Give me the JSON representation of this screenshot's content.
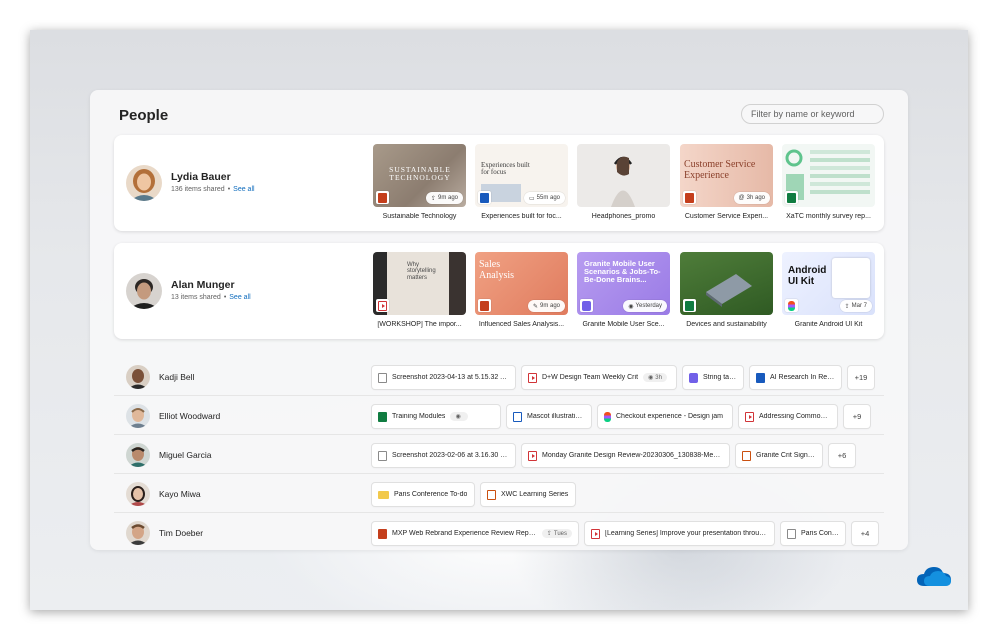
{
  "panel": {
    "title": "People",
    "filter_placeholder": "Filter by name or keyword"
  },
  "people_cards": [
    {
      "name": "Lydia Bauer",
      "subtitle": "136 items shared",
      "see_all": "See all",
      "files": [
        {
          "caption": "Sustainable Technology",
          "badge": "9m ago",
          "type": "powerpoint",
          "art_text": "SUSTAINABLE TECHNOLOGY"
        },
        {
          "caption": "Experiences built for foc...",
          "badge": "55m ago",
          "type": "word",
          "art_text": "Experiences built for focus"
        },
        {
          "caption": "Headphones_promo",
          "badge": "",
          "type": "image",
          "art_text": ""
        },
        {
          "caption": "Customer Service Experi...",
          "badge": "3h ago",
          "type": "powerpoint",
          "art_text": "Customer Service Experience"
        },
        {
          "caption": "XaTC monthly survey rep...",
          "badge": "",
          "type": "excel",
          "art_text": ""
        }
      ]
    },
    {
      "name": "Alan Munger",
      "subtitle": "13 items shared",
      "see_all": "See all",
      "files": [
        {
          "caption": "[WORKSHOP] The impor...",
          "badge": "",
          "type": "video",
          "art_text": "Why storytelling matters"
        },
        {
          "caption": "Influenced Sales Analysis...",
          "badge": "9m ago",
          "type": "powerpoint",
          "art_text": "Sales Analysis"
        },
        {
          "caption": "Granite Mobile User Sce...",
          "badge": "Yesterday",
          "type": "loop",
          "art_text": "Granite Mobile User Scenarios & Jobs-To-Be-Done Brains..."
        },
        {
          "caption": "Devices and sustainability",
          "badge": "",
          "type": "excel",
          "art_text": ""
        },
        {
          "caption": "Granite Android UI Kit",
          "badge": "Mar 7",
          "type": "figma",
          "art_text": "Android UI Kit"
        }
      ]
    }
  ],
  "people_rows": [
    {
      "name": "Kadji Bell",
      "files": [
        {
          "label": "Screenshot 2023-04-13 at 5.15.32 AM",
          "icon": "image",
          "badge": ""
        },
        {
          "label": "D+W Design Team Weekly Crit",
          "icon": "video",
          "badge": "3h"
        },
        {
          "label": "String table",
          "icon": "loop",
          "badge": ""
        },
        {
          "label": "AI Research In Resh...",
          "icon": "word",
          "badge": ""
        }
      ],
      "more": "+19"
    },
    {
      "name": "Elliot Woodward",
      "files": [
        {
          "label": "Training Modules",
          "icon": "excel",
          "badge": "49m ago"
        },
        {
          "label": "Mascot illustrations",
          "icon": "doc",
          "badge": ""
        },
        {
          "label": "Checkout experience - Design jam",
          "icon": "figma",
          "badge": ""
        },
        {
          "label": "Addressing Common Mi...",
          "icon": "video",
          "badge": ""
        }
      ],
      "more": "+9"
    },
    {
      "name": "Miguel Garcia",
      "files": [
        {
          "label": "Screenshot 2023-02-06 at 3.16.30 PM",
          "icon": "image",
          "badge": ""
        },
        {
          "label": "Monday Granite Design Review-20230306_130838-Meeti...",
          "icon": "video",
          "badge": ""
        },
        {
          "label": "Granite Crit Sign up",
          "icon": "whiteboard",
          "badge": ""
        }
      ],
      "more": "+6"
    },
    {
      "name": "Kayo Miwa",
      "files": [
        {
          "label": "Paris Conference To-do",
          "icon": "folder",
          "badge": ""
        },
        {
          "label": "XWC Learning Series",
          "icon": "whiteboard",
          "badge": ""
        }
      ],
      "more": ""
    },
    {
      "name": "Tim Doeber",
      "files": [
        {
          "label": "MXP Web Rebrand Experience Review Report",
          "icon": "powerpoint",
          "badge": "Tues"
        },
        {
          "label": "[Learning Series] Improve your presentation throug...",
          "icon": "video",
          "badge": ""
        },
        {
          "label": "Paris Confe...",
          "icon": "image",
          "badge": ""
        }
      ],
      "more": "+4"
    }
  ],
  "colors": {
    "accent": "#0f6cbd",
    "onedrive": "#0364b8"
  }
}
